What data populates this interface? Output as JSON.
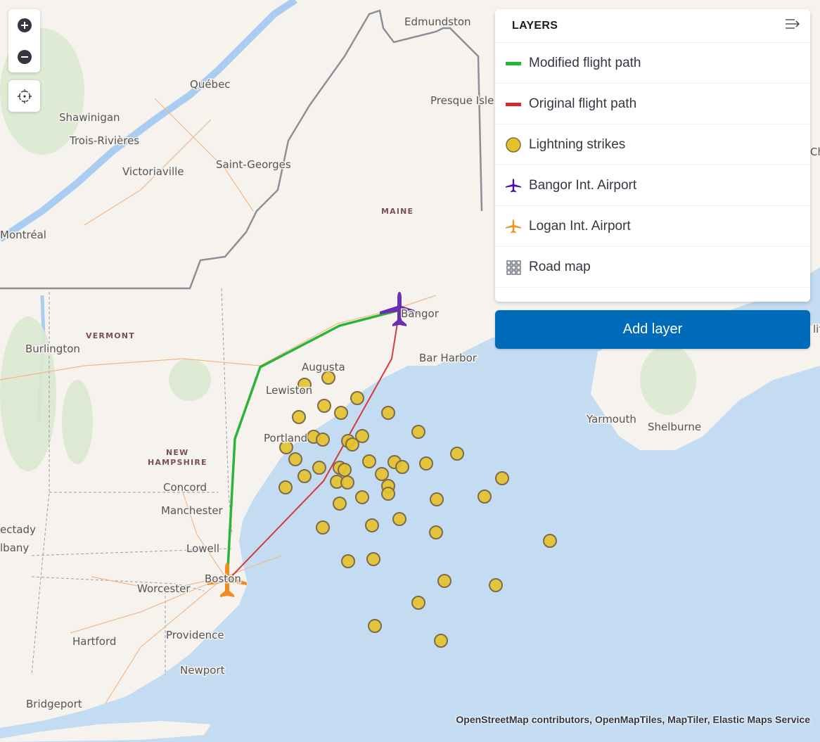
{
  "map": {
    "controls": {
      "zoom_in": "zoom-in",
      "zoom_out": "zoom-out",
      "locate": "fit-to-data"
    },
    "place_labels": [
      "Edmundston",
      "Québec",
      "Presque Isle",
      "Shawinigan",
      "Trois-Rivières",
      "Victoriaville",
      "Saint-Georges",
      "Montréal",
      "Burlington",
      "Augusta",
      "Lewiston",
      "Bangor",
      "Bar Harbor",
      "Portland",
      "Concord",
      "Manchester",
      "Lowell",
      "Boston",
      "Worcester",
      "Hartford",
      "Providence",
      "Newport",
      "Bridgeport",
      "Yarmouth",
      "Shelburne",
      "ectady",
      "lbany",
      "Ch",
      "lif"
    ],
    "state_labels": [
      "MAINE",
      "VERMONT",
      "NEW",
      "HAMPSHIRE"
    ],
    "lightning_strike_count": 46,
    "colors": {
      "modified_path": "#2db33a",
      "original_path": "#d63a3a",
      "lightning": "#e6c229",
      "lightning_border": "#7d6a4f",
      "bangor_airport": "#6a2fb0",
      "logan_airport": "#f28a1c",
      "water": "#c3dcf2",
      "land": "#f6f3ef"
    }
  },
  "layers_panel": {
    "title": "LAYERS",
    "collapse_icon": "collapse-panel-icon",
    "layers": [
      {
        "label": "Modified flight path",
        "icon": "line-swatch",
        "color": "#1db82b"
      },
      {
        "label": "Original flight path",
        "icon": "line-swatch",
        "color": "#d62c2c"
      },
      {
        "label": "Lightning strikes",
        "icon": "circle-swatch",
        "color": "#e6c229"
      },
      {
        "label": "Bangor Int. Airport",
        "icon": "airport-icon",
        "color": "#4b0fa6"
      },
      {
        "label": "Logan Int. Airport",
        "icon": "airport-icon",
        "color": "#f5901f"
      },
      {
        "label": "Road map",
        "icon": "grid-icon",
        "color": "#555a64"
      }
    ],
    "add_layer_label": "Add layer"
  },
  "attribution": "OpenStreetMap contributors, OpenMapTiles, MapTiler, Elastic Maps Service"
}
